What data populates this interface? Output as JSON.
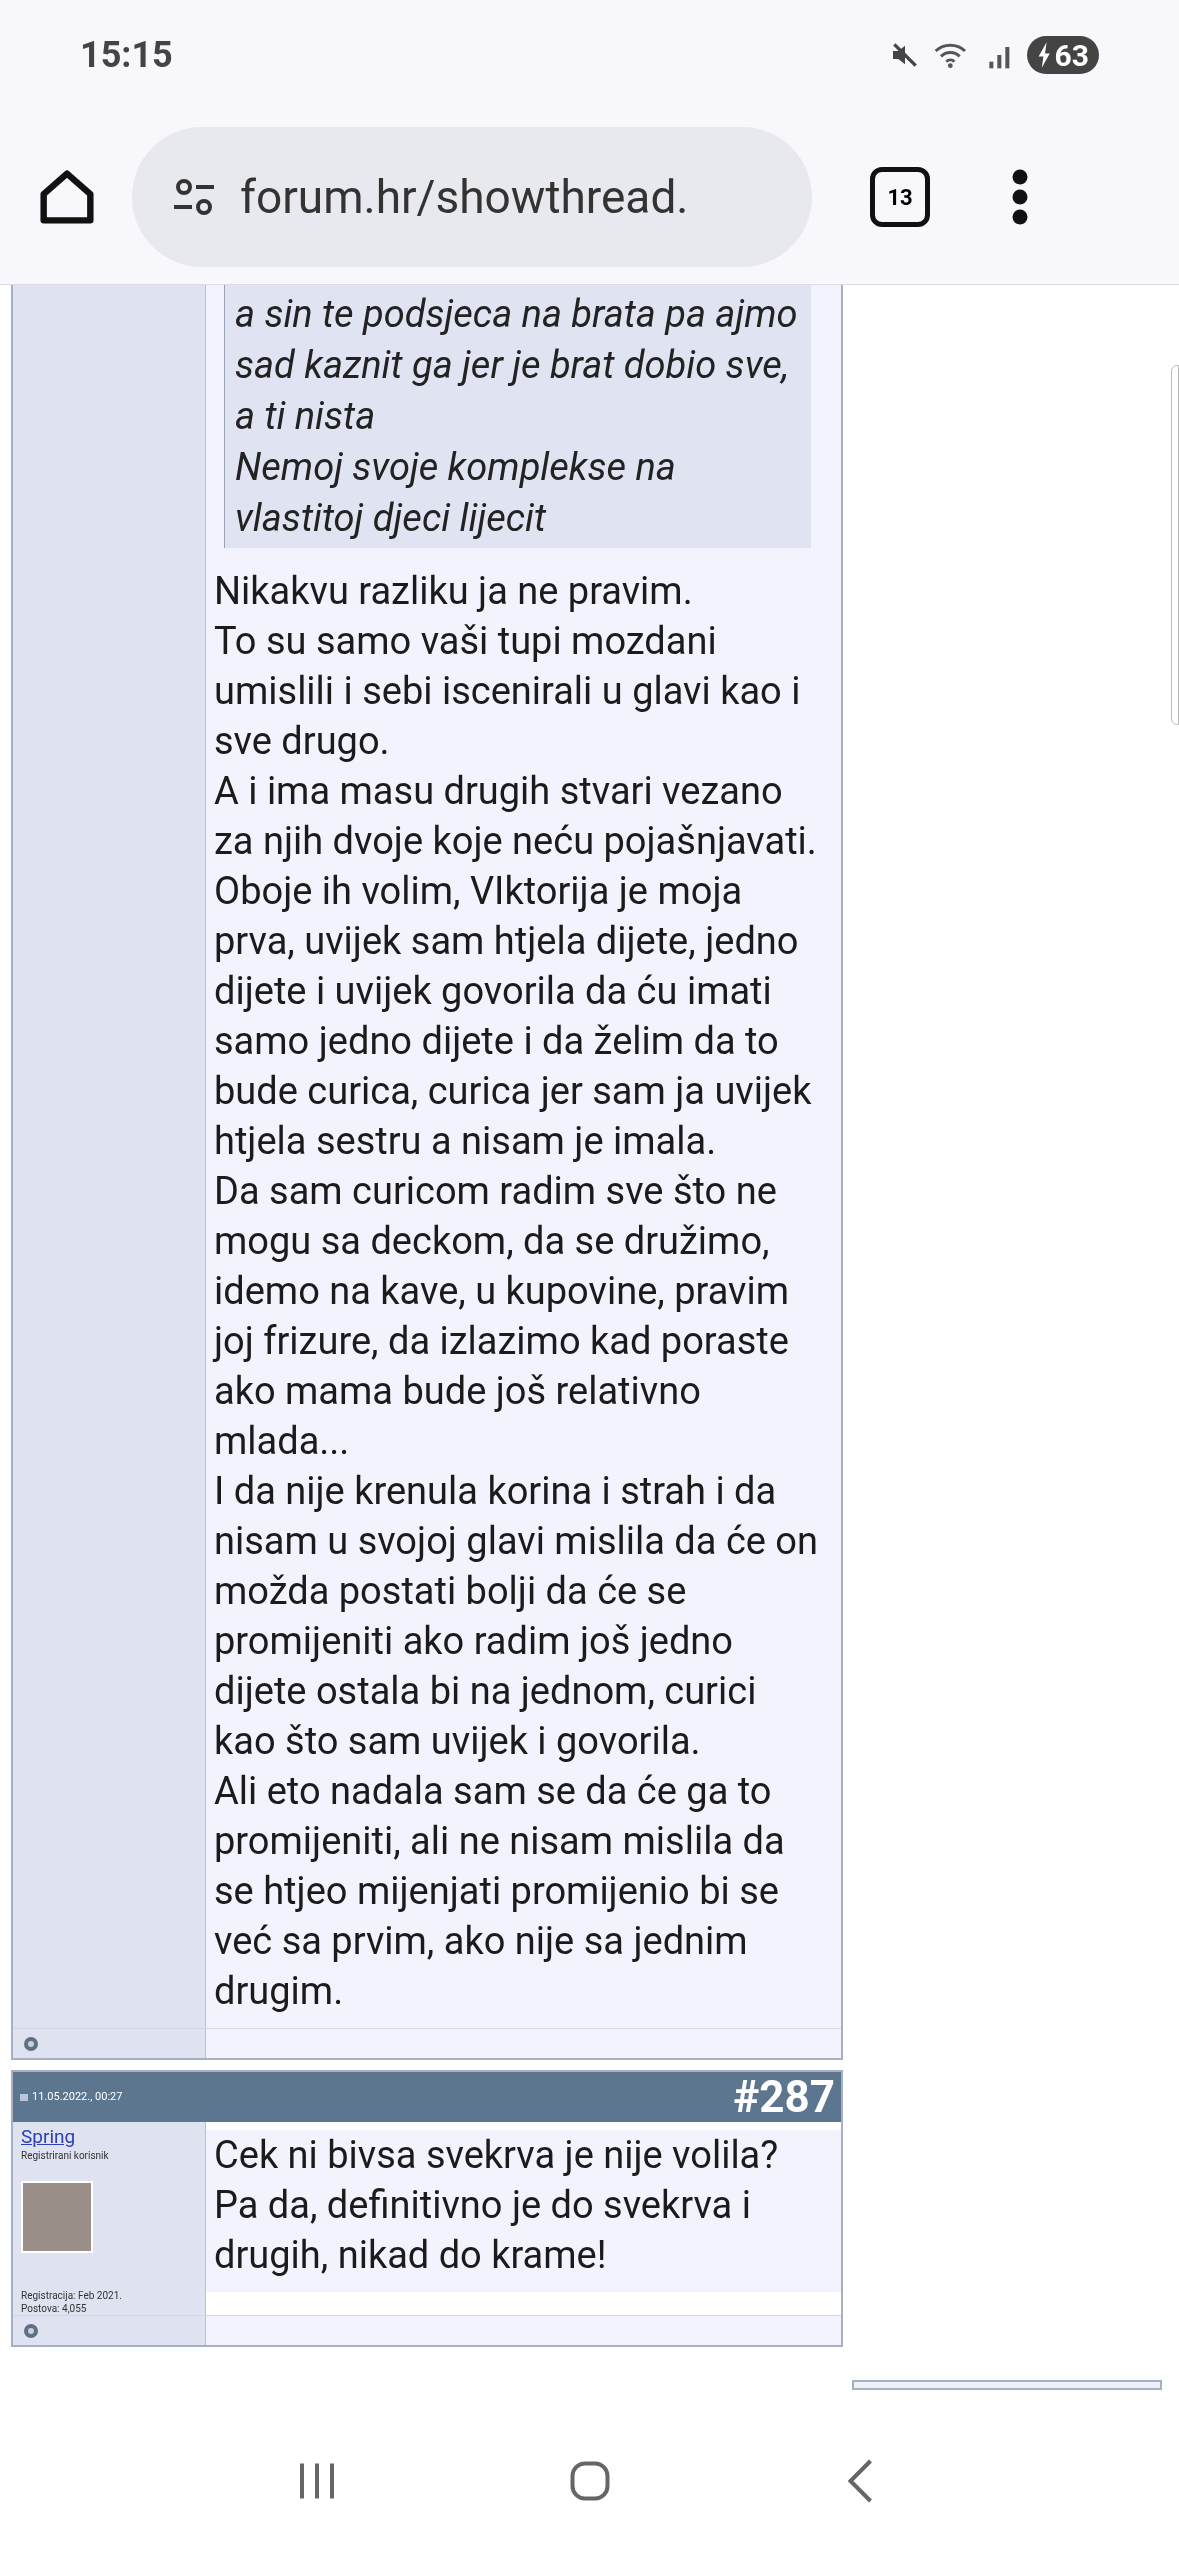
{
  "status_bar": {
    "time": "15:15",
    "battery": "63"
  },
  "browser": {
    "url": "forum.hr/showthread.",
    "tab_count": "13"
  },
  "posts": [
    {
      "quote": [
        "a sin te podsjeca na brata pa ajmo sad kaznit ga jer je brat dobio sve, a ti nista",
        "Nemoj svoje komplekse na vlastitoj djeci lijecit"
      ],
      "paragraphs": [
        "Nikakvu razliku ja ne pravim.",
        "To su samo vaši tupi mozdani umislili i sebi iscenirali u glavi kao i sve drugo.",
        "A i ima masu drugih stvari vezano za njih dvoje koje neću pojašnjavati.",
        "Oboje ih volim, VIktorija je moja prva, uvijek sam htjela dijete, jedno dijete i uvijek govorila da ću imati samo jedno dijete i da želim da to bude curica, curica jer sam ja uvijek htjela sestru a nisam je imala.",
        "Da sam curicom radim sve što ne mogu sa deckom, da se družimo, idemo na kave, u kupovine, pravim joj frizure, da izlazimo kad poraste ako mama bude još relativno mlada...",
        "I da nije krenula korina i strah i da nisam u svojoj glavi mislila da će on možda postati bolji da će se promijeniti ako radim još jedno dijete ostala bi na jednom, curici kao što sam uvijek i govorila.",
        "Ali eto nadala sam se da će ga to promijeniti, ali ne nisam mislila da se htjeo mijenjati promijenio bi se već sa prvim, ako nije sa jednim drugim."
      ]
    },
    {
      "date": "11.05.2022., 00:27",
      "number": "#287",
      "user": {
        "name": "Spring",
        "rank": "Registrirani korisnik",
        "joined": "Registracija: Feb 2021.",
        "post_count": "Postova: 4,055"
      },
      "paragraphs": [
        "Cek ni bivsa svekrva je nije volila? Pa da, definitivno je do svekrva i drugih, nikad do krame!"
      ]
    }
  ]
}
